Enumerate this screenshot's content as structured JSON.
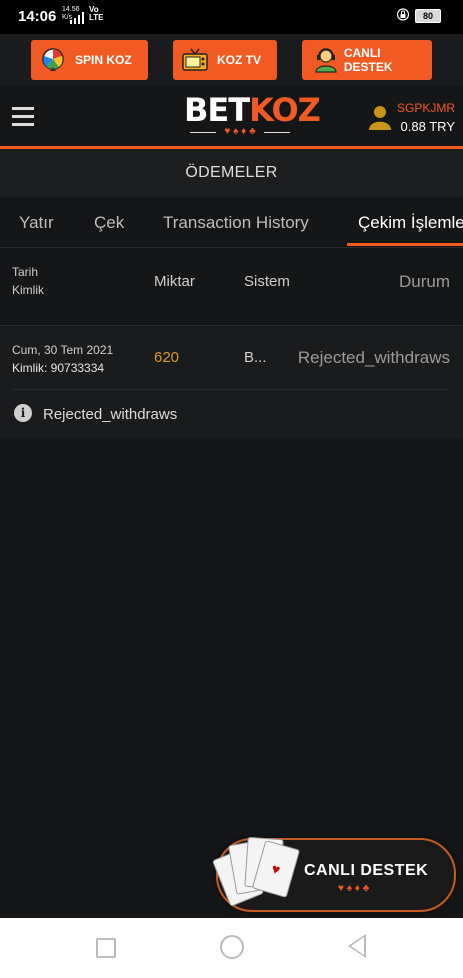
{
  "status_bar": {
    "time": "14:06",
    "net_speed": "14.56\nK/s",
    "net_type": "Vo\nLTE",
    "battery": "80"
  },
  "promo_buttons": [
    {
      "label": "SPIN KOZ",
      "icon": "wheel-icon"
    },
    {
      "label": "KOZ TV",
      "icon": "tv-icon"
    },
    {
      "label": "CANLI DESTEK",
      "icon": "support-agent-icon"
    }
  ],
  "header": {
    "logo": {
      "part1": "BET",
      "part2": "KOZ",
      "suits": "♥ ♠ ♦ ♣"
    },
    "username": "SGPKJMR",
    "balance": "0.88 TRY"
  },
  "page_title": "ÖDEMELER",
  "tabs": [
    {
      "label": "Yatır"
    },
    {
      "label": "Çek"
    },
    {
      "label": "Transaction History"
    },
    {
      "label": "Çekim İşlemleri",
      "active": true
    }
  ],
  "table": {
    "headers": {
      "date": "Tarih",
      "id": "Kimlik",
      "amount": "Miktar",
      "system": "Sistem",
      "status": "Durum"
    },
    "rows": [
      {
        "date": "Cum, 30 Tem 2021",
        "id": "Kimlik: 90733334",
        "amount": "620",
        "system": "B...",
        "status": "Rejected_withdraws",
        "note": "Rejected_withdraws"
      }
    ]
  },
  "floating_button": {
    "label": "CANLI DESTEK",
    "suits": "♥ ♠ ♦ ♣"
  },
  "colors": {
    "accent": "#f15a22",
    "background": "#151618",
    "amount": "#e0962e"
  }
}
